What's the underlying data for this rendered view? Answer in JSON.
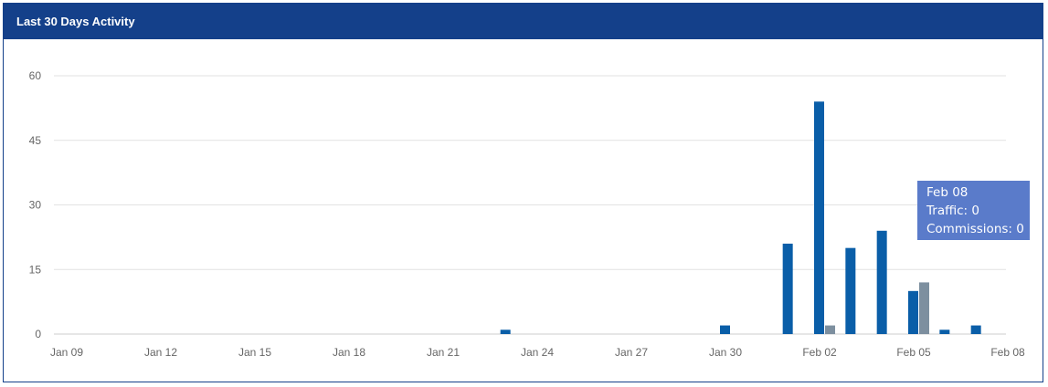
{
  "panel": {
    "title": "Last 30 Days Activity"
  },
  "tooltip": {
    "date": "Feb 08",
    "traffic_line": "Traffic: 0",
    "commissions_line": "Commissions: 0"
  },
  "colors": {
    "traffic": "#0a5ea8",
    "commissions": "#7d8f9f",
    "header": "#14408a",
    "tooltip": "#5a7bca"
  },
  "chart_data": {
    "type": "bar",
    "title": "",
    "xlabel": "",
    "ylabel": "",
    "ylim": [
      0,
      60
    ],
    "yticks": [
      0,
      15,
      30,
      45,
      60
    ],
    "grid": true,
    "x_tick_labels": [
      "Jan 09",
      "Jan 12",
      "Jan 15",
      "Jan 18",
      "Jan 21",
      "Jan 24",
      "Jan 27",
      "Jan 30",
      "Feb 02",
      "Feb 05",
      "Feb 08"
    ],
    "categories": [
      "Jan 09",
      "Jan 10",
      "Jan 11",
      "Jan 12",
      "Jan 13",
      "Jan 14",
      "Jan 15",
      "Jan 16",
      "Jan 17",
      "Jan 18",
      "Jan 19",
      "Jan 20",
      "Jan 21",
      "Jan 22",
      "Jan 23",
      "Jan 24",
      "Jan 25",
      "Jan 26",
      "Jan 27",
      "Jan 28",
      "Jan 29",
      "Jan 30",
      "Jan 31",
      "Feb 01",
      "Feb 02",
      "Feb 03",
      "Feb 04",
      "Feb 05",
      "Feb 06",
      "Feb 07",
      "Feb 08"
    ],
    "series": [
      {
        "name": "Traffic",
        "values": [
          0,
          0,
          0,
          0,
          0,
          0,
          0,
          0,
          0,
          0,
          0,
          0,
          0,
          0,
          1,
          0,
          0,
          0,
          0,
          0,
          0,
          2,
          0,
          21,
          54,
          20,
          24,
          10,
          1,
          2,
          0
        ]
      },
      {
        "name": "Commissions",
        "values": [
          0,
          0,
          0,
          0,
          0,
          0,
          0,
          0,
          0,
          0,
          0,
          0,
          0,
          0,
          0,
          0,
          0,
          0,
          0,
          0,
          0,
          0,
          0,
          0,
          2,
          0,
          0,
          12,
          0,
          0,
          0
        ]
      }
    ]
  }
}
